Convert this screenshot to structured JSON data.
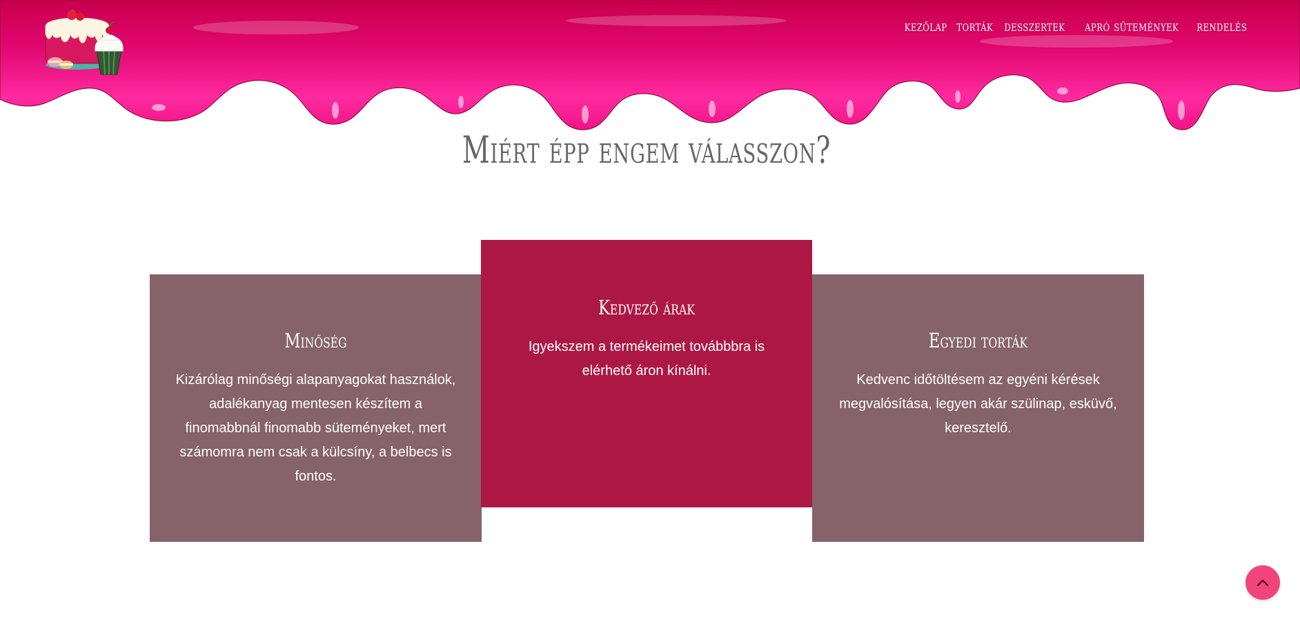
{
  "brand": {
    "logo_icon": "cake-cupcake-logo-icon"
  },
  "nav": {
    "items": [
      {
        "label": "kezőlap"
      },
      {
        "label": "torták"
      },
      {
        "label": "desszertek"
      },
      {
        "label": "apró sütemények"
      },
      {
        "label": "rendelés"
      }
    ]
  },
  "section": {
    "title": "Miért épp engem válasszon?"
  },
  "cards": [
    {
      "title": "Minőség",
      "text": "Kizárólag minőségi alapanyagokat használok, adalékanyag mentesen készítem a finomabbnál finomabb süteményeket, mert számomra nem csak a külcsíny, a belbecs is fontos."
    },
    {
      "title": "Kedvező árak",
      "text": "Igyekszem a termékeimet továbbbra is elérhető áron kínálni."
    },
    {
      "title": "Egyedi torták",
      "text": "Kedvenc időtöltésem az egyéni kérések megvalósítása, legyen akár szülinap, esküvő, keresztelő."
    }
  ],
  "back_to_top": {
    "icon": "chevron-up-icon"
  },
  "colors": {
    "drip_pink": "#f0148a",
    "drip_dark": "#c5004e",
    "card_side": "#86626a",
    "card_accent": "#ad1746",
    "back_to_top": "#f0447c",
    "title_gray": "#666666"
  }
}
